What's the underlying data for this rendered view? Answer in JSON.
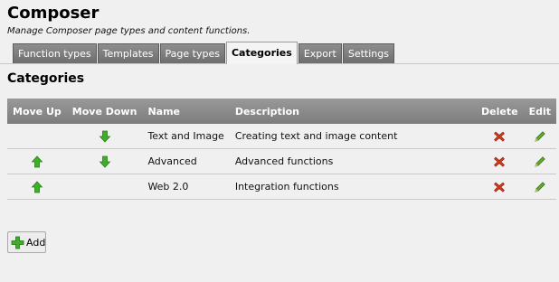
{
  "header": {
    "title": "Composer",
    "subtitle": "Manage Composer page types and content functions."
  },
  "tabs": [
    {
      "label": "Function types",
      "active": false
    },
    {
      "label": "Templates",
      "active": false
    },
    {
      "label": "Page types",
      "active": false
    },
    {
      "label": "Categories",
      "active": true
    },
    {
      "label": "Export",
      "active": false
    },
    {
      "label": "Settings",
      "active": false
    }
  ],
  "section": {
    "title": "Categories"
  },
  "table": {
    "columns": {
      "move_up": "Move Up",
      "move_down": "Move Down",
      "name": "Name",
      "description": "Description",
      "delete": "Delete",
      "edit": "Edit"
    },
    "rows": [
      {
        "name": "Text and Image",
        "description": "Creating text and image content",
        "can_move_up": false,
        "can_move_down": true
      },
      {
        "name": "Advanced",
        "description": "Advanced functions",
        "can_move_up": true,
        "can_move_down": true
      },
      {
        "name": "Web 2.0",
        "description": "Integration functions",
        "can_move_up": true,
        "can_move_down": false
      }
    ]
  },
  "add_button": {
    "label": "Add",
    "icon": "plus-icon"
  },
  "icons": {
    "move_up": "arrow-up-icon",
    "move_down": "arrow-down-icon",
    "delete": "delete-x-icon",
    "edit": "pencil-icon"
  },
  "colors": {
    "arrow_green": "#3fae29",
    "delete_red": "#d03a1e",
    "edit_green": "#5fa92b",
    "header_gray": "#8a8a8a"
  }
}
